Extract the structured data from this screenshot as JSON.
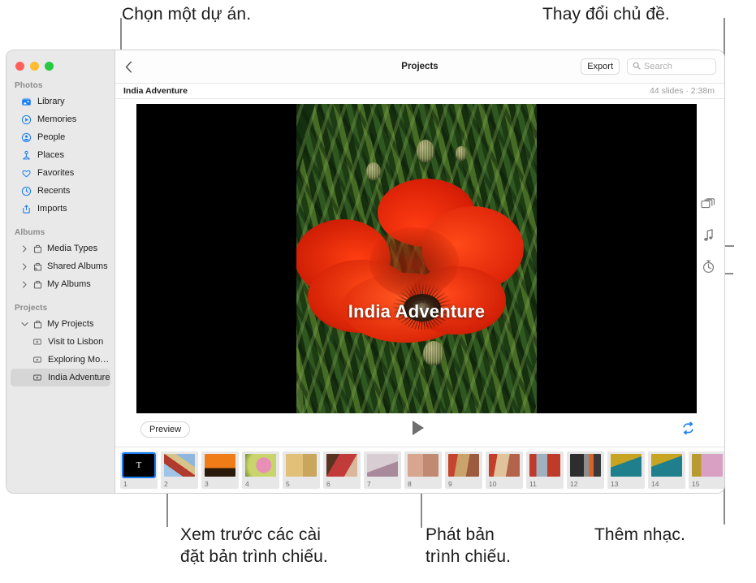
{
  "callouts": [
    {
      "id": "select-project",
      "text": "Chọn một dự án."
    },
    {
      "id": "change-theme",
      "text": "Thay đổi chủ đề."
    },
    {
      "id": "preview-settings",
      "text": "Xem trước các cài\nđặt bản trình chiếu."
    },
    {
      "id": "play-slideshow",
      "text": "Phát bản\ntrình chiếu."
    },
    {
      "id": "add-music",
      "text": "Thêm nhạc."
    }
  ],
  "window": {
    "traffic_lights": [
      "close",
      "minimize",
      "zoom"
    ]
  },
  "sidebar": {
    "sections": [
      {
        "title": "Photos",
        "items": [
          {
            "label": "Library",
            "icon": "library-icon",
            "selected": false
          },
          {
            "label": "Memories",
            "icon": "memories-icon",
            "selected": false
          },
          {
            "label": "People",
            "icon": "people-icon",
            "selected": false
          },
          {
            "label": "Places",
            "icon": "places-icon",
            "selected": false
          },
          {
            "label": "Favorites",
            "icon": "heart-icon",
            "selected": false
          },
          {
            "label": "Recents",
            "icon": "clock-icon",
            "selected": false
          },
          {
            "label": "Imports",
            "icon": "import-icon",
            "selected": false
          }
        ]
      },
      {
        "title": "Albums",
        "items": [
          {
            "label": "Media Types",
            "icon": "folder-icon",
            "disclosure": "collapsed"
          },
          {
            "label": "Shared Albums",
            "icon": "shared-folder-icon",
            "disclosure": "collapsed"
          },
          {
            "label": "My Albums",
            "icon": "folder-icon",
            "disclosure": "collapsed"
          }
        ]
      },
      {
        "title": "Projects",
        "items": [
          {
            "label": "My Projects",
            "icon": "folder-icon",
            "disclosure": "expanded"
          },
          {
            "label": "Visit to Lisbon",
            "icon": "project-icon",
            "nested": true,
            "selected": false
          },
          {
            "label": "Exploring Mor…",
            "icon": "project-icon",
            "nested": true,
            "selected": false
          },
          {
            "label": "India Adventure",
            "icon": "project-icon",
            "nested": true,
            "selected": true
          }
        ]
      }
    ]
  },
  "toolbar": {
    "back_label": "back",
    "title": "Projects",
    "export_label": "Export",
    "search_placeholder": "Search"
  },
  "subbar": {
    "project_name": "India Adventure",
    "meta": "44 slides · 2:38m"
  },
  "stage": {
    "slide_title": "India Adventure",
    "letterbox_color": "#000000"
  },
  "transport": {
    "preview_label": "Preview",
    "play_label": "play",
    "loop_label": "repeat",
    "loop_color": "#1c7ef3"
  },
  "filmstrip": {
    "add_label": "+",
    "slides": [
      {
        "n": "1",
        "kind": "title",
        "selected": true,
        "c1": "#000000",
        "c2": "#1a1a1a",
        "glyph": "T"
      },
      {
        "n": "2",
        "kind": "photo",
        "selected": false,
        "c1": "#9fc4e6",
        "c2": "#b03a2e"
      },
      {
        "n": "3",
        "kind": "photo",
        "selected": false,
        "c1": "#f07c18",
        "c2": "#2a1a0c"
      },
      {
        "n": "4",
        "kind": "photo",
        "selected": false,
        "c1": "#e88fb8",
        "c2": "#6d8a2f"
      },
      {
        "n": "5",
        "kind": "photo",
        "selected": false,
        "c1": "#d9b066",
        "c2": "#7a5a2a"
      },
      {
        "n": "6",
        "kind": "photo",
        "selected": false,
        "c1": "#c23b3b",
        "c2": "#5a3320"
      },
      {
        "n": "7",
        "kind": "photo",
        "selected": false,
        "c1": "#cfc2c9",
        "c2": "#8d6d82"
      },
      {
        "n": "8",
        "kind": "photo",
        "selected": false,
        "c1": "#d8a58e",
        "c2": "#4a3830"
      },
      {
        "n": "9",
        "kind": "photo",
        "selected": false,
        "c1": "#c4452c",
        "c2": "#caa36b"
      },
      {
        "n": "10",
        "kind": "photo",
        "selected": false,
        "c1": "#c33f2b",
        "c2": "#e0c39a"
      },
      {
        "n": "11",
        "kind": "photo",
        "selected": false,
        "c1": "#bf3a28",
        "c2": "#9fb0bf"
      },
      {
        "n": "12",
        "kind": "photo",
        "selected": false,
        "c1": "#2e2e2e",
        "c2": "#d8622a"
      },
      {
        "n": "13",
        "kind": "photo",
        "selected": false,
        "c1": "#c8a423",
        "c2": "#1f7f8c"
      },
      {
        "n": "14",
        "kind": "photo",
        "selected": false,
        "c1": "#c8a423",
        "c2": "#1f7f8c"
      },
      {
        "n": "15",
        "kind": "photo",
        "selected": false,
        "c1": "#b99a2e",
        "c2": "#d9a0c4"
      }
    ]
  },
  "rail": {
    "items": [
      {
        "icon": "themes-icon",
        "label": "Themes"
      },
      {
        "icon": "music-icon",
        "label": "Music"
      },
      {
        "icon": "duration-icon",
        "label": "Duration"
      }
    ]
  }
}
